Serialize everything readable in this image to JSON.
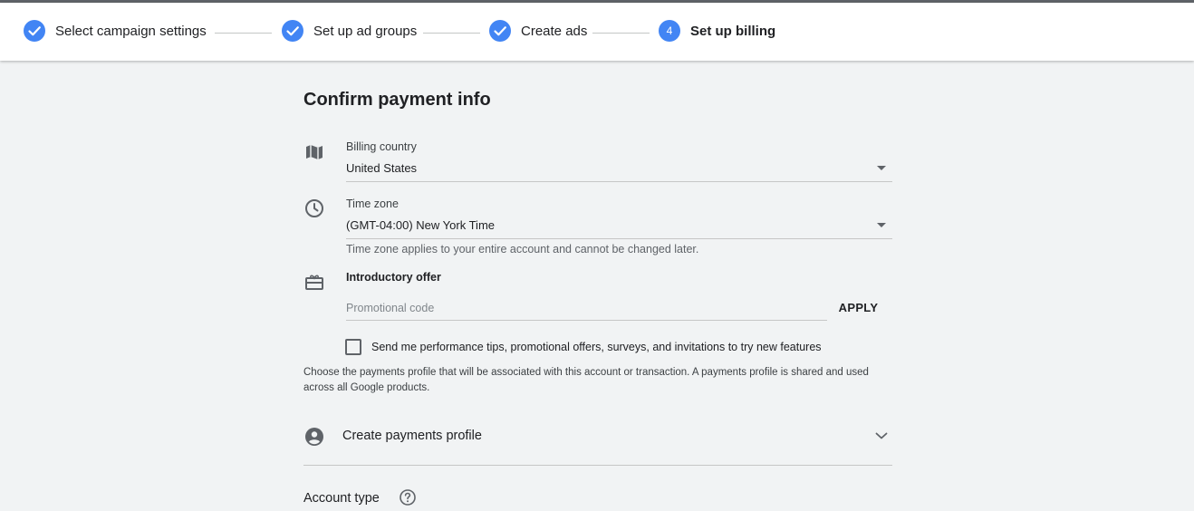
{
  "stepper": {
    "steps": [
      {
        "number": "1",
        "label": "Select campaign settings",
        "state": "complete"
      },
      {
        "number": "2",
        "label": "Set up ad groups",
        "state": "complete"
      },
      {
        "number": "3",
        "label": "Create ads",
        "state": "complete"
      },
      {
        "number": "4",
        "label": "Set up billing",
        "state": "active"
      }
    ],
    "accent_color": "#4285f4"
  },
  "page": {
    "title": "Confirm payment info"
  },
  "billing_country": {
    "icon": "map-icon",
    "label": "Billing country",
    "value": "United States"
  },
  "time_zone": {
    "icon": "clock-icon",
    "label": "Time zone",
    "value": "(GMT-04:00) New York Time",
    "helper": "Time zone applies to your entire account and cannot be changed later."
  },
  "intro_offer": {
    "icon": "gift-card-icon",
    "label": "Introductory offer",
    "placeholder": "Promotional code",
    "value": "",
    "apply_label": "APPLY"
  },
  "tips_checkbox": {
    "checked": false,
    "label": "Send me performance tips, promotional offers, surveys, and invitations to try new features"
  },
  "payments_info": "Choose the payments profile that will be associated with this account or transaction. A payments profile is shared and used across all Google products.",
  "payments_profile": {
    "icon": "account-circle-icon",
    "label": "Create payments profile",
    "expanded": false
  },
  "account_type": {
    "label": "Account type",
    "icon": "help-icon"
  }
}
